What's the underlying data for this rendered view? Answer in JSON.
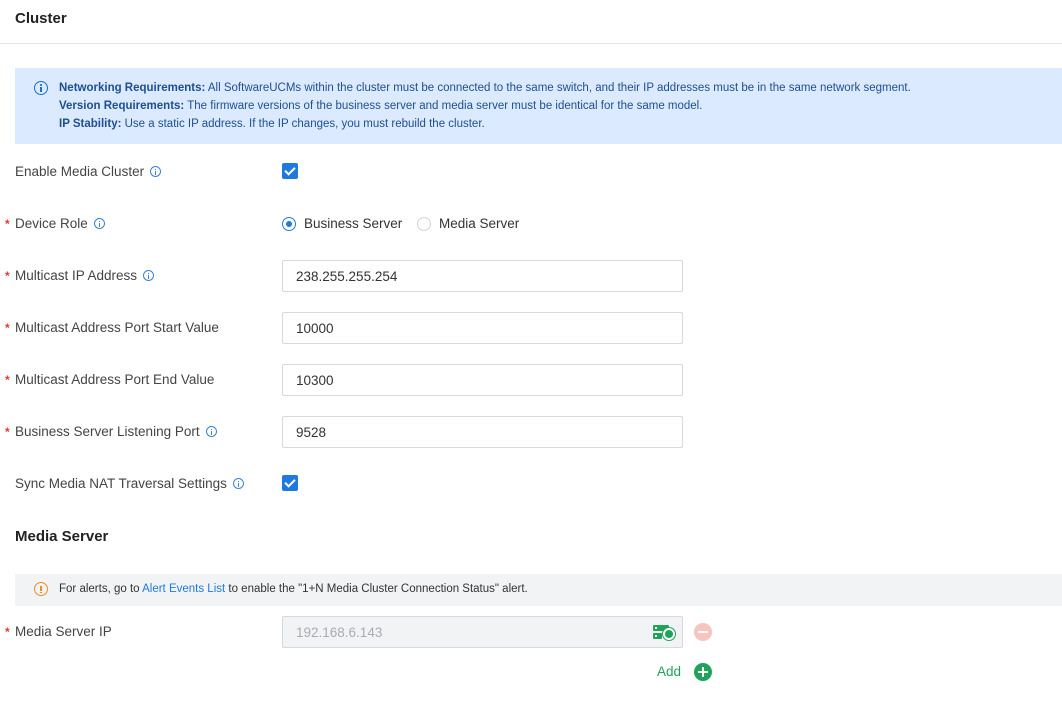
{
  "page": {
    "title": "Cluster"
  },
  "info": {
    "networking_title": "Networking Requirements:",
    "networking_text": " All SoftwareUCMs within the cluster must be connected to the same switch, and their IP addresses must be in the same network segment.",
    "version_title": "Version Requirements:",
    "version_text": " The firmware versions of the business server and media server must be identical for the same model.",
    "ip_title": "IP Stability:",
    "ip_text": " Use a static IP address. If the IP changes, you must rebuild the cluster."
  },
  "form": {
    "enable_media_cluster": {
      "label": "Enable Media Cluster",
      "checked": true
    },
    "device_role": {
      "label": "Device Role",
      "options": [
        "Business Server",
        "Media Server"
      ],
      "selected": "Business Server"
    },
    "multicast_ip": {
      "label": "Multicast IP Address",
      "value": "238.255.255.254"
    },
    "port_start": {
      "label": "Multicast Address Port Start Value",
      "value": "10000"
    },
    "port_end": {
      "label": "Multicast Address Port End Value",
      "value": "10300"
    },
    "listening_port": {
      "label": "Business Server Listening Port",
      "value": "9528"
    },
    "sync_nat": {
      "label": "Sync Media NAT Traversal Settings",
      "checked": true
    }
  },
  "media_server": {
    "title": "Media Server",
    "alert_prefix": "For alerts, go to ",
    "alert_link": "Alert Events List",
    "alert_suffix": " to enable the \"1+N Media Cluster Connection Status\" alert.",
    "ip_label": "Media Server IP",
    "ip_value": "192.168.6.143",
    "add_label": "Add"
  },
  "required_marker": "*",
  "colors": {
    "accent": "#1f7ae0",
    "success": "#1fa35a",
    "required": "#e53935",
    "info_bg": "#dbeafe",
    "warning": "#f08a24"
  }
}
